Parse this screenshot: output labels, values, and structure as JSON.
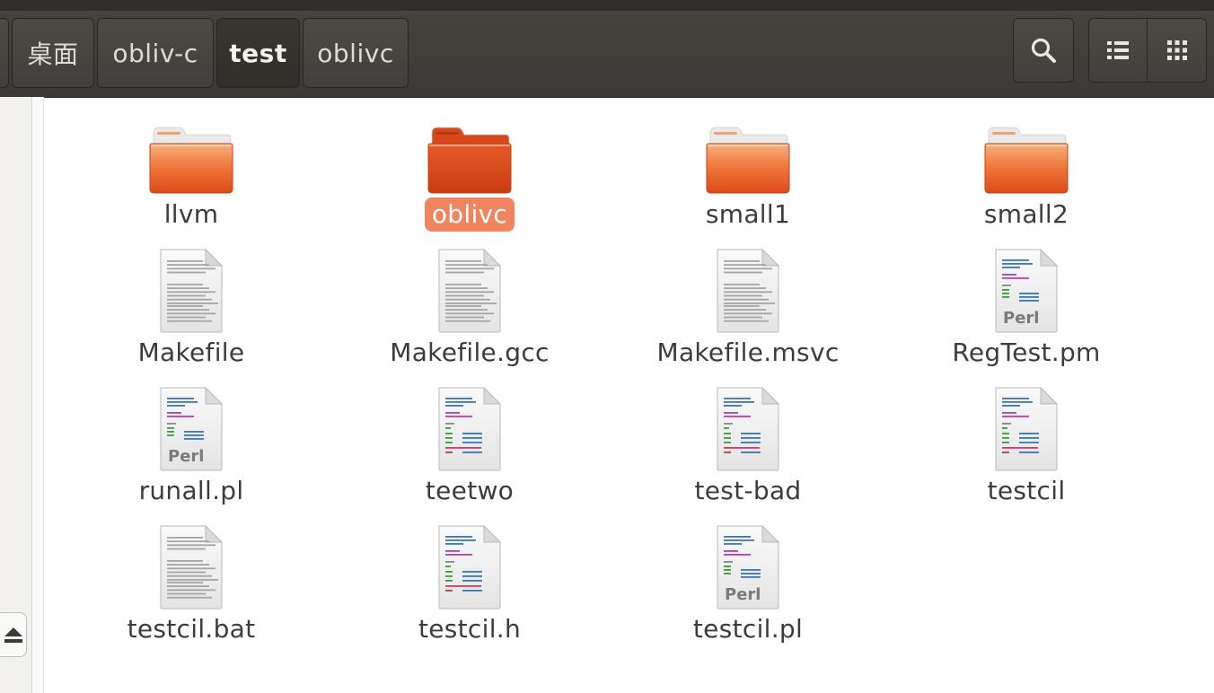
{
  "breadcrumb": {
    "items": [
      {
        "label": "桌面",
        "active": false
      },
      {
        "label": "obliv-c",
        "active": false
      },
      {
        "label": "test",
        "active": true
      },
      {
        "label": "oblivc",
        "active": false
      }
    ]
  },
  "toolbar": {
    "search_icon": "search-icon",
    "view_list_icon": "view-list-icon",
    "view_grid_icon": "view-grid-icon"
  },
  "sidebar": {
    "eject_icon": "eject-icon"
  },
  "files": [
    {
      "name": "llvm",
      "type": "folder",
      "selected": false
    },
    {
      "name": "oblivc",
      "type": "folder",
      "selected": true
    },
    {
      "name": "small1",
      "type": "folder",
      "selected": false
    },
    {
      "name": "small2",
      "type": "folder",
      "selected": false
    },
    {
      "name": "Makefile",
      "type": "text",
      "selected": false
    },
    {
      "name": "Makefile.gcc",
      "type": "text",
      "selected": false
    },
    {
      "name": "Makefile.msvc",
      "type": "text",
      "selected": false
    },
    {
      "name": "RegTest.pm",
      "type": "perl",
      "selected": false
    },
    {
      "name": "runall.pl",
      "type": "perl",
      "selected": false
    },
    {
      "name": "teetwo",
      "type": "code",
      "selected": false
    },
    {
      "name": "test-bad",
      "type": "code",
      "selected": false
    },
    {
      "name": "testcil",
      "type": "code",
      "selected": false
    },
    {
      "name": "testcil.bat",
      "type": "text",
      "selected": false
    },
    {
      "name": "testcil.h",
      "type": "code",
      "selected": false
    },
    {
      "name": "testcil.pl",
      "type": "perl",
      "selected": false
    }
  ],
  "perl_badge": "Perl",
  "colors": {
    "accent": "#e95420",
    "selection": "#f0845f",
    "headerbar": "#3f3e3a"
  }
}
